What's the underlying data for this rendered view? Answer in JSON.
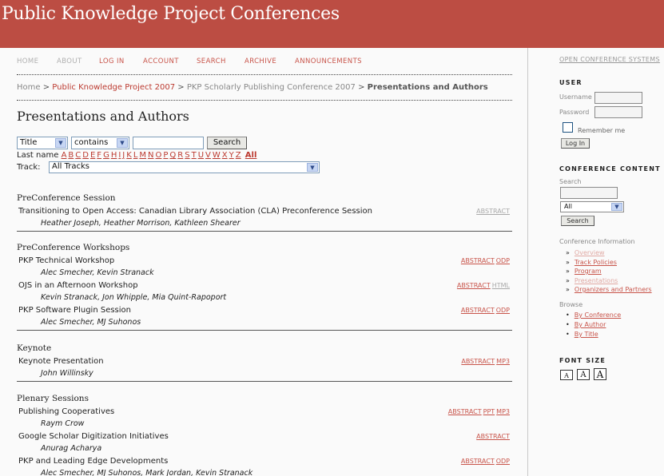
{
  "header": {
    "title": "Public Knowledge Project Conferences"
  },
  "nav": {
    "items": [
      "HOME",
      "ABOUT",
      "LOG IN",
      "ACCOUNT",
      "SEARCH",
      "ARCHIVE",
      "ANNOUNCEMENTS"
    ]
  },
  "breadcrumb": {
    "home": "Home",
    "conference": "Public Knowledge Project 2007",
    "sched_conf": "PKP Scholarly Publishing Conference 2007",
    "current": "Presentations and Authors",
    "separator": ">"
  },
  "page_title": "Presentations and Authors",
  "search_form": {
    "field_select": "Title",
    "operator_select": "contains",
    "query": "",
    "search_button": "Search",
    "last_name_label": "Last name",
    "letters": [
      "A",
      "B",
      "C",
      "D",
      "E",
      "F",
      "G",
      "H",
      "I",
      "J",
      "K",
      "L",
      "M",
      "N",
      "O",
      "P",
      "Q",
      "R",
      "S",
      "T",
      "U",
      "V",
      "W",
      "X",
      "Y",
      "Z"
    ],
    "all_label": "All",
    "track_label": "Track:",
    "track_select": "All Tracks"
  },
  "sessions": [
    {
      "heading": "PreConference Session",
      "papers": [
        {
          "title": "Transitioning to Open Access: Canadian Library Association (CLA) Preconference Session",
          "authors": "Heather Joseph, Heather Morrison, Kathleen Shearer",
          "links": [
            {
              "label": "ABSTRACT",
              "muted": true
            }
          ]
        }
      ]
    },
    {
      "heading": "PreConference Workshops",
      "papers": [
        {
          "title": "PKP Technical Workshop",
          "authors": "Alec Smecher, Kevin Stranack",
          "links": [
            {
              "label": "ABSTRACT",
              "muted": false
            },
            {
              "label": "ODP",
              "muted": false
            }
          ]
        },
        {
          "title": "OJS in an Afternoon Workshop",
          "authors": "Kevin Stranack, Jon Whipple, Mia Quint-Rapoport",
          "links": [
            {
              "label": "ABSTRACT",
              "muted": false
            },
            {
              "label": "HTML",
              "muted": true
            }
          ]
        },
        {
          "title": "PKP Software Plugin Session",
          "authors": "Alec Smecher, MJ Suhonos",
          "links": [
            {
              "label": "ABSTRACT",
              "muted": false
            },
            {
              "label": "ODP",
              "muted": false
            }
          ]
        }
      ]
    },
    {
      "heading": "Keynote",
      "papers": [
        {
          "title": "Keynote Presentation",
          "authors": "John Willinsky",
          "links": [
            {
              "label": "ABSTRACT",
              "muted": false
            },
            {
              "label": "MP3",
              "muted": false
            }
          ]
        }
      ]
    },
    {
      "heading": "Plenary Sessions",
      "papers": [
        {
          "title": "Publishing Cooperatives",
          "authors": "Raym Crow",
          "links": [
            {
              "label": "ABSTRACT",
              "muted": false
            },
            {
              "label": "PPT",
              "muted": false
            },
            {
              "label": "MP3",
              "muted": false
            }
          ]
        },
        {
          "title": "Google Scholar Digitization Initiatives",
          "authors": "Anurag Acharya",
          "links": [
            {
              "label": "ABSTRACT",
              "muted": false
            }
          ]
        },
        {
          "title": "PKP and Leading Edge Developments",
          "authors": "Alec Smecher, MJ Suhonos, Mark Jordan, Kevin Stranack",
          "links": [
            {
              "label": "ABSTRACT",
              "muted": false
            },
            {
              "label": "ODP",
              "muted": false
            }
          ]
        }
      ]
    }
  ],
  "sidebar": {
    "ocs_link": "OPEN CONFERENCE SYSTEMS",
    "user": {
      "heading": "USER",
      "username_label": "Username",
      "password_label": "Password",
      "remember_label": "Remember me",
      "login_button": "Log In"
    },
    "conference_content": {
      "heading": "CONFERENCE CONTENT",
      "search_label": "Search",
      "scope_select": "All",
      "search_button": "Search",
      "info_heading": "Conference Information",
      "info_items": [
        {
          "label": "Overview",
          "muted": true
        },
        {
          "label": "Track Policies",
          "muted": false
        },
        {
          "label": "Program",
          "muted": false
        },
        {
          "label": "Presentations",
          "muted": true
        },
        {
          "label": "Organizers and Partners",
          "muted": false
        }
      ],
      "browse_heading": "Browse",
      "browse_items": [
        "By Conference",
        "By Author",
        "By Title"
      ]
    },
    "font_size": {
      "heading": "FONT SIZE",
      "buttons": [
        "A",
        "A",
        "A"
      ]
    }
  },
  "colors": {
    "header_bg": "#bc4d43",
    "link": "#c8544a",
    "muted": "#a9a9a9"
  }
}
